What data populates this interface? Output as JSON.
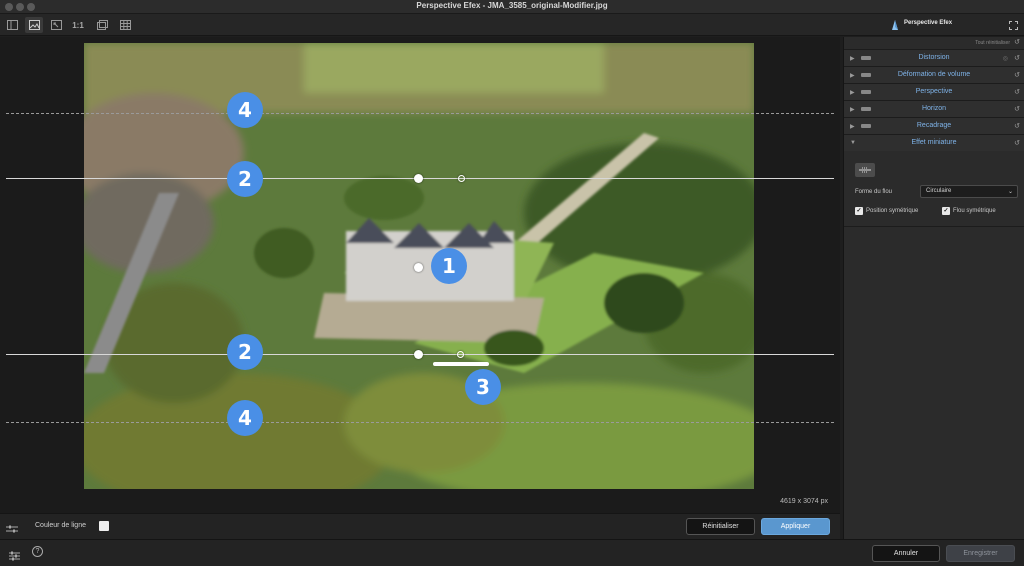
{
  "window": {
    "title": "Perspective Efex - JMA_3585_original-Modifier.jpg"
  },
  "toolbar": {
    "zoom_label": "1:1",
    "app_name": "Perspective Efex",
    "icons": [
      "panel-toggle-icon",
      "image-view-icon",
      "fit-screen-icon",
      "zoom-1-1",
      "compare-icon",
      "grid-icon",
      "fullscreen-icon"
    ]
  },
  "canvas": {
    "image_dimensions": "4619 x 3074 px",
    "markers": [
      "1",
      "2",
      "2",
      "3",
      "4",
      "4"
    ]
  },
  "canvas_bottom": {
    "line_color_label": "Couleur de ligne",
    "reset_label": "Réinitialiser",
    "apply_label": "Appliquer"
  },
  "panel": {
    "reset_all_label": "Tout réinitialiser",
    "sections": [
      {
        "name": "Distorsion",
        "expanded": false
      },
      {
        "name": "Déformation de volume",
        "expanded": false
      },
      {
        "name": "Perspective",
        "expanded": false
      },
      {
        "name": "Horizon",
        "expanded": false
      },
      {
        "name": "Recadrage",
        "expanded": false
      },
      {
        "name": "Effet miniature",
        "expanded": true
      }
    ],
    "mini": {
      "blur_shape_label": "Forme du flou",
      "blur_shape_value": "Circulaire",
      "sym_position_label": "Position symétrique",
      "sym_position_checked": true,
      "sym_blur_label": "Flou symétrique",
      "sym_blur_checked": true
    }
  },
  "footer": {
    "cancel_label": "Annuler",
    "save_label": "Enregistrer"
  },
  "colors": {
    "accent": "#5a97cf",
    "marker": "#4a8fe6",
    "section_title": "#7fb3e8"
  }
}
